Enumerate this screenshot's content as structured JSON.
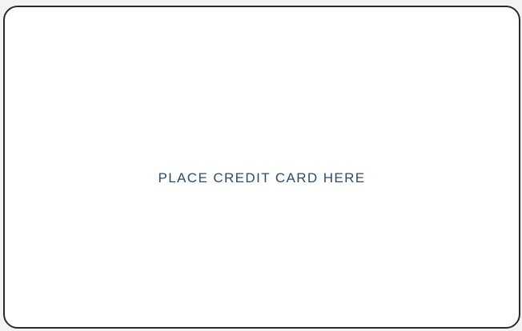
{
  "card_area": {
    "prompt": "PLACE CREDIT CARD HERE"
  },
  "colors": {
    "prompt_text": "#2f4b6b",
    "frame_border": "#2a2a2a",
    "frame_fill": "#ffffff",
    "page_background": "#f3f3f3"
  }
}
